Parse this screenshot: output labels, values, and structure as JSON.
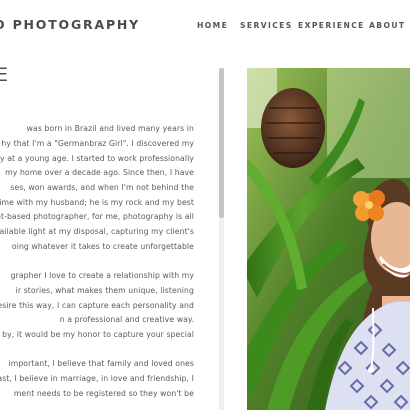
{
  "header": {
    "logo": "O PHOTOGRAPHY",
    "nav": {
      "home": "HOME",
      "services": "SERVICES",
      "experience": "EXPERIENCE",
      "about": "ABOUT ME"
    }
  },
  "about": {
    "title": "E",
    "lines": [
      "was born in Brazil and lived many years in",
      "hy that I'm a \"Germanbraz Girl\". I discovered my",
      "hy at a young age. I started to work professionally",
      "my home over a decade ago. Since then, I have",
      "ses, won awards, and when I'm not behind the",
      "g time with my husband; he is my rock and my best",
      "ght-based photographer, for me, photography is all",
      "ll available light at my disposal, capturing my client's",
      "oing whatever it takes to create unforgettable",
      "",
      "grapher I love to create a relationship with my",
      "ir stories, what makes them unique, listening",
      "desire this way, I can capture each personality and",
      "n a professional and creative way.",
      "g by, it would be my honor to capture your special",
      "",
      "important, I believe that family and loved ones",
      "fast, I believe in marriage, in love and friendship, I",
      "ment needs to be registered so they won't be"
    ]
  },
  "photo": {
    "icon": "portrait-photo-image"
  }
}
